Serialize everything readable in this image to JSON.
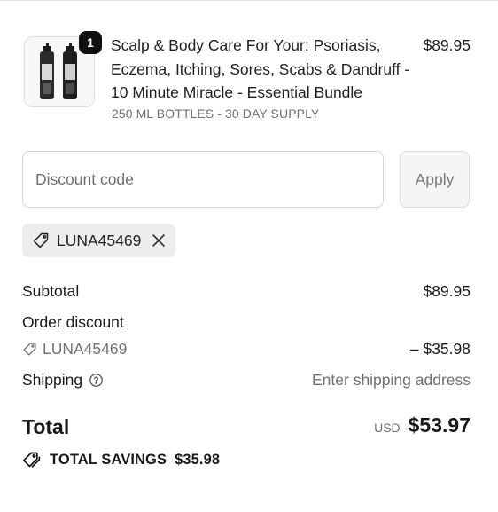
{
  "product": {
    "quantity": "1",
    "name": "Scalp & Body Care For Your: Psoriasis, Eczema, Itching, Sores, Scabs & Dandruff - 10 Minute Miracle - Essential Bundle",
    "variant": "250 ML BOTTLES - 30 DAY SUPPLY",
    "price": "$89.95"
  },
  "discount": {
    "placeholder": "Discount code",
    "apply_label": "Apply",
    "applied_code": "LUNA45469"
  },
  "summary": {
    "subtotal_label": "Subtotal",
    "subtotal_value": "$89.95",
    "order_discount_label": "Order discount",
    "discount_code": "LUNA45469",
    "discount_value": "– $35.98",
    "shipping_label": "Shipping",
    "shipping_value": "Enter shipping address",
    "total_label": "Total",
    "currency": "USD",
    "total_value": "$53.97",
    "savings_label": "TOTAL SAVINGS",
    "savings_value": "$35.98"
  },
  "icons": {
    "tag": "tag-icon",
    "remove": "close-icon",
    "help": "help-circle-icon",
    "savings": "tags-icon"
  }
}
